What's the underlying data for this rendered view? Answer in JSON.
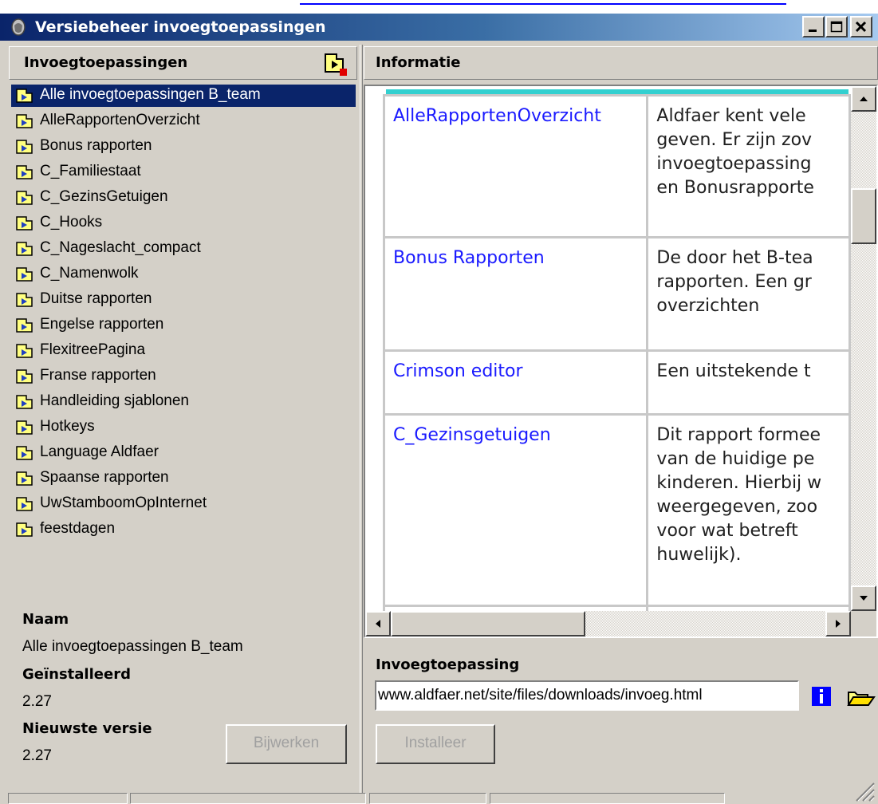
{
  "window": {
    "title": "Versiebeheer invoegtoepassingen",
    "caption_buttons": [
      "minimize-icon",
      "maximize-icon",
      "close-icon"
    ]
  },
  "left_panel": {
    "header": "Invoegtoepassingen",
    "plugins": [
      "Alle invoegtoepassingen B_team",
      "AlleRapportenOverzicht",
      "Bonus rapporten",
      "C_Familiestaat",
      "C_GezinsGetuigen",
      "C_Hooks",
      "C_Nageslacht_compact",
      "C_Namenwolk",
      "Duitse rapporten",
      "Engelse rapporten",
      "FlexitreePagina",
      "Franse rapporten",
      "Handleiding sjablonen",
      "Hotkeys",
      "Language Aldfaer",
      "Spaanse rapporten",
      "UwStamboomOpInternet",
      "feestdagen"
    ],
    "selected_index": 0,
    "naam_label": "Naam",
    "naam_value": "Alle invoegtoepassingen B_team",
    "geinstalleerd_label": "Geïnstalleerd",
    "geinstalleerd_value": "2.27",
    "nieuwste_label": "Nieuwste versie",
    "nieuwste_value": "2.27",
    "bijwerken_button": "Bijwerken"
  },
  "right_panel": {
    "header": "Informatie",
    "table_rows": [
      {
        "name": "AlleRapportenOverzicht",
        "desc": [
          "Aldfaer kent vele",
          "geven. Er zijn zov",
          "invoegtoepassing",
          "en Bonusrapporte"
        ]
      },
      {
        "name": "Bonus Rapporten",
        "desc": [
          "De door het B-tea",
          "rapporten. Een gr",
          "overzichten"
        ]
      },
      {
        "name": "Crimson editor",
        "desc": [
          "Een uitstekende t"
        ]
      },
      {
        "name": "C_Gezinsgetuigen",
        "desc": [
          "Dit rapport formee",
          "van de huidige pe",
          "kinderen. Hierbij w",
          "weergegeven, zoo",
          "voor wat betreft",
          "huwelijk)."
        ]
      }
    ],
    "invoeg_label": "Invoegtoepassing",
    "url_value": "www.aldfaer.net/site/files/downloads/invoeg.html",
    "installeer_button": "Installeer",
    "info_icon": "info-icon",
    "folder_icon": "folder-open-icon"
  },
  "colors": {
    "selection": "#0a246a",
    "link": "#1a1aff",
    "window_bg": "#d4d0c8",
    "teal_accent": "#33d0d0"
  }
}
